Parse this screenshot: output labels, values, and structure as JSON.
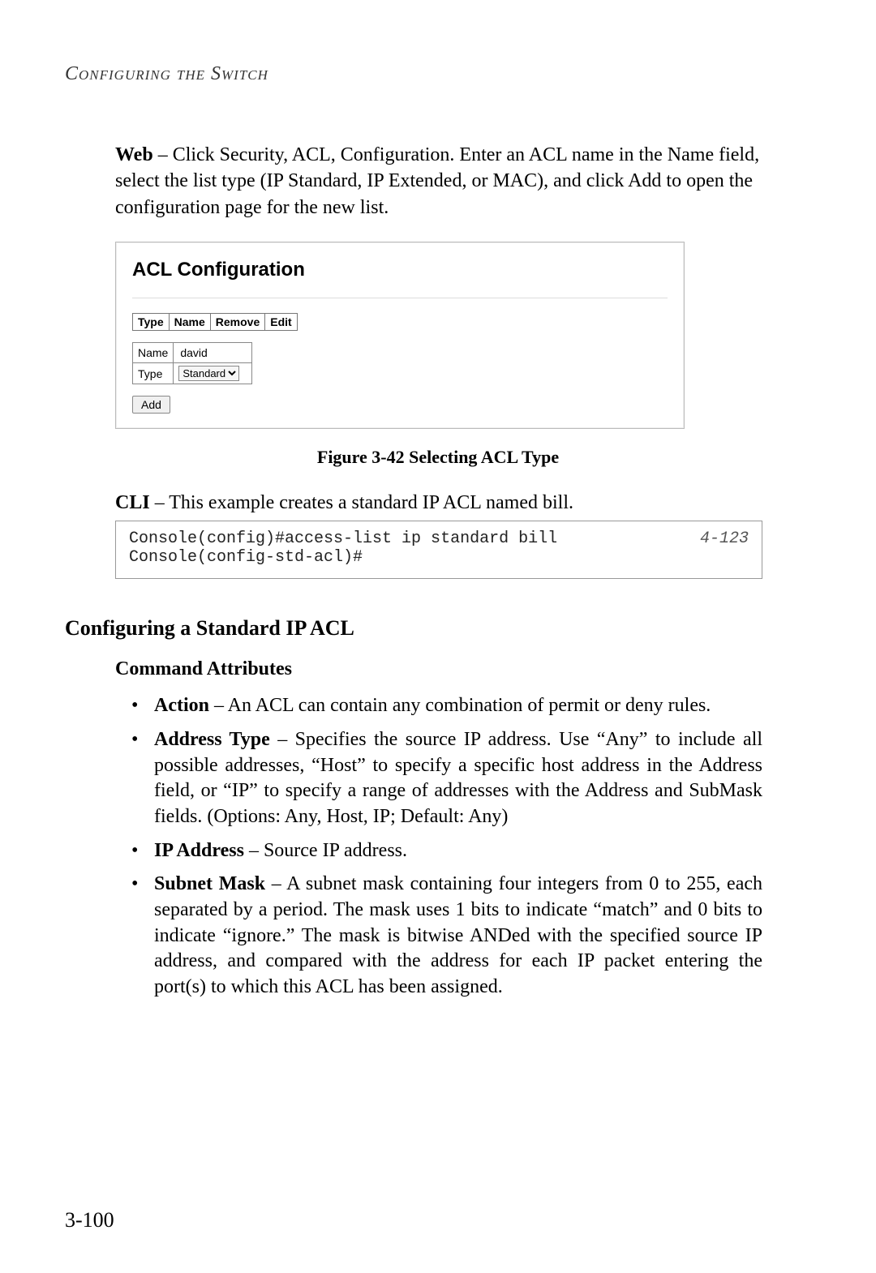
{
  "header": "Configuring the Switch",
  "intro": {
    "lead_label": "Web",
    "lead_text": " – Click Security, ACL, Configuration. Enter an ACL name in the Name field, select the list type (IP Standard, IP Extended, or MAC), and click Add to open the configuration page for the new list."
  },
  "screenshot": {
    "title": "ACL Configuration",
    "columns": [
      "Type",
      "Name",
      "Remove",
      "Edit"
    ],
    "form": {
      "name_label": "Name",
      "name_value": "david",
      "type_label": "Type",
      "type_selected": "Standard",
      "type_options": [
        "Standard"
      ]
    },
    "add_button": "Add"
  },
  "figure_caption": "Figure 3-42  Selecting ACL Type",
  "cli": {
    "lead_label": "CLI",
    "lead_text": " – This example creates a standard IP ACL named bill.",
    "line1": "Console(config)#access-list ip standard bill",
    "ref": "4-123",
    "line2": "Console(config-std-acl)#"
  },
  "section_heading": "Configuring a Standard IP ACL",
  "subsection_heading": "Command Attributes",
  "bullets": [
    {
      "term": "Action",
      "text": " – An ACL can contain any combination of permit or deny rules."
    },
    {
      "term": "Address Type",
      "text": " – Specifies the source IP address. Use “Any” to include all possible addresses, “Host” to specify a specific host address in the Address field, or “IP” to specify a range of addresses with the Address and SubMask fields. (Options: Any, Host, IP; Default: Any)"
    },
    {
      "term": "IP Address",
      "text": " – Source IP address."
    },
    {
      "term": "Subnet Mask",
      "text": " – A subnet mask containing four integers from 0 to 255, each separated by a period. The mask uses 1 bits to indicate “match” and 0 bits to indicate “ignore.” The mask is bitwise ANDed with the specified source IP address, and compared with the address for each IP packet entering the port(s) to which this ACL has been assigned."
    }
  ],
  "page_number": "3-100"
}
